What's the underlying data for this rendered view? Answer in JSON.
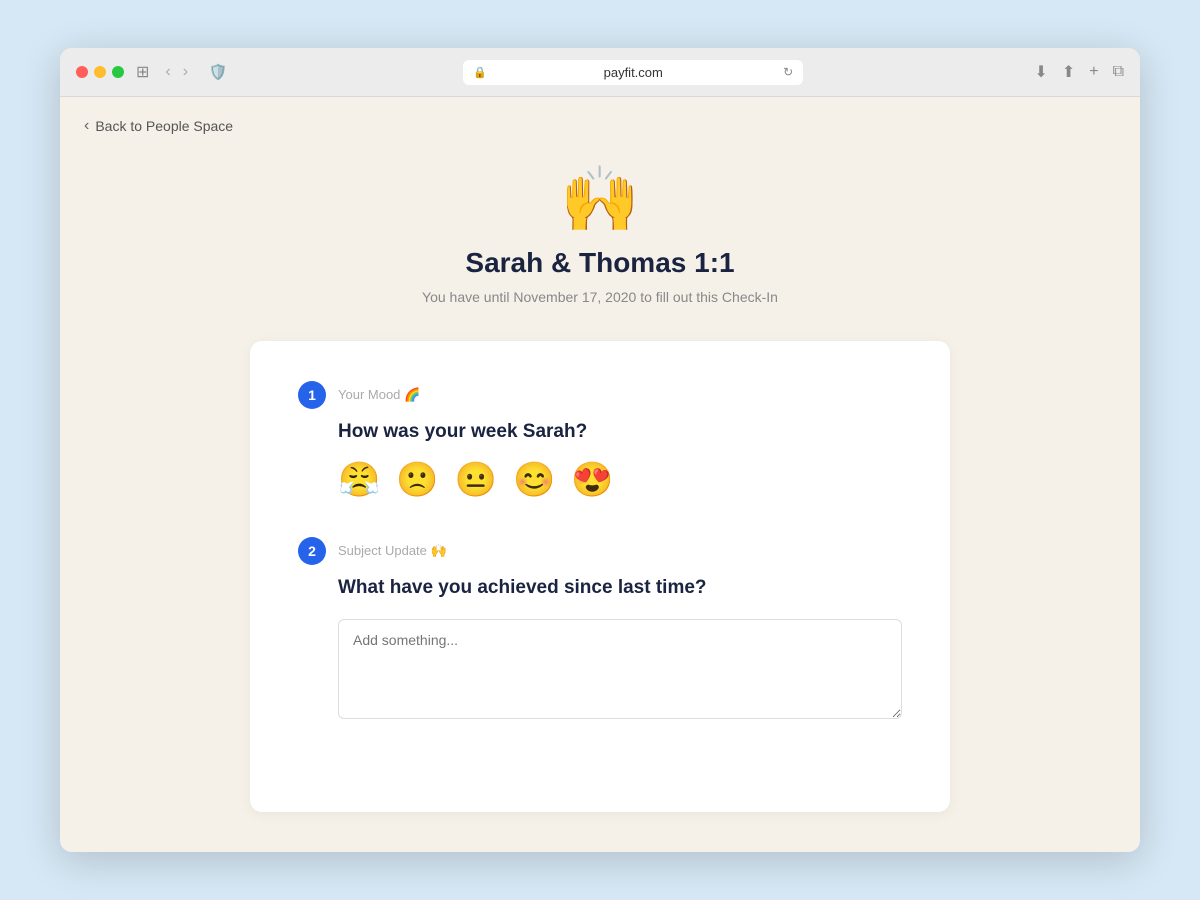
{
  "browser": {
    "url": "payfit.com",
    "shield_icon": "🛡",
    "lock_icon": "🔒"
  },
  "nav": {
    "back_label": "Back to People Space"
  },
  "hero": {
    "emoji": "🙌",
    "title": "Sarah & Thomas 1:1",
    "subtitle": "You have until November 17, 2020 to fill out this Check-In"
  },
  "questions": [
    {
      "number": "1",
      "label": "Your Mood 🌈",
      "text": "How was your week Sarah?",
      "type": "mood",
      "moods": [
        "😤",
        "🙁",
        "😐",
        "😊",
        "😍"
      ]
    },
    {
      "number": "2",
      "label": "Subject Update 🙌",
      "text": "What have you achieved since last time?",
      "type": "textarea",
      "placeholder": "Add something..."
    }
  ]
}
